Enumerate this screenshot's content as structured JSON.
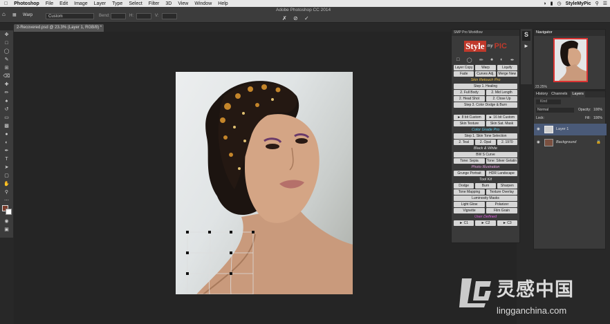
{
  "menubar": {
    "apple": "",
    "items": [
      "Photoshop",
      "File",
      "Edit",
      "Image",
      "Layer",
      "Type",
      "Select",
      "Filter",
      "3D",
      "View",
      "Window",
      "Help"
    ],
    "right_user": "StyleMyPic",
    "right_icons": [
      "wifi-icon",
      "battery-icon",
      "clock-icon",
      "search-icon",
      "list-icon"
    ]
  },
  "options": {
    "tool_label": "Warp",
    "warp_value": "Custom",
    "bend_label": "Bend:",
    "hv_label": "H:",
    "v_label": "V:",
    "window_title": "Adobe Photoshop CC 2014"
  },
  "document": {
    "tab_title": "2-Recovered.psd @ 23.3% (Layer 1, RGB/8) *"
  },
  "smp": {
    "title": "SMP Pro Workflow",
    "logo_style": "Style",
    "logo_my": "my",
    "logo_pic": "PIC",
    "rows": [
      {
        "type": "buttons",
        "items": [
          "Layer Copy",
          "Warp",
          "Liquify"
        ]
      },
      {
        "type": "buttons",
        "items": [
          "Fade",
          "Curves Adj.",
          "Merge New"
        ]
      },
      {
        "type": "section",
        "label": "Skin Retouch Pro",
        "color": "#f0c040"
      },
      {
        "type": "buttons",
        "items": [
          "Step 1. Healing"
        ]
      },
      {
        "type": "buttons",
        "items": [
          "2. Full Body",
          "2. Mid Length"
        ]
      },
      {
        "type": "buttons",
        "items": [
          "2. Head Shot",
          "2. Close Up"
        ]
      },
      {
        "type": "buttons",
        "items": [
          "Step 3. Color Dodge & Burn"
        ]
      },
      {
        "type": "section",
        "label": "",
        "color": "#ccc"
      },
      {
        "type": "buttons",
        "items": [
          "► 8 bit Custom",
          "► 16 bit Custom"
        ]
      },
      {
        "type": "buttons",
        "items": [
          "Skin Texture",
          "Skin Sat. Mask"
        ]
      },
      {
        "type": "section",
        "label": "Color Grade Pro",
        "color": "#5ad0f0"
      },
      {
        "type": "buttons",
        "items": [
          "Step 1. Skin Tone Selection"
        ]
      },
      {
        "type": "buttons",
        "items": [
          "2. Teal",
          "2. Opal",
          "2. 1970"
        ]
      },
      {
        "type": "section",
        "label": "Black & White",
        "color": "#e6e6e6"
      },
      {
        "type": "buttons",
        "items": [
          "BW S Curve"
        ]
      },
      {
        "type": "buttons",
        "items": [
          "Tone: Sepia",
          "Tone: Silver Gelatin"
        ]
      },
      {
        "type": "section",
        "label": "Photo Illustration",
        "color": "#e6a0e0"
      },
      {
        "type": "buttons",
        "items": [
          "Grunge Portrait",
          "HDR Landscape"
        ]
      },
      {
        "type": "section",
        "label": "Tool Kit",
        "color": "#e6e6e6"
      },
      {
        "type": "buttons",
        "items": [
          "Dodge",
          "Burn",
          "Sharpen"
        ]
      },
      {
        "type": "buttons",
        "items": [
          "Tone Mapping",
          "Texture Overlay"
        ]
      },
      {
        "type": "buttons",
        "items": [
          "Luminosity Masks"
        ]
      },
      {
        "type": "buttons",
        "items": [
          "Light Glow",
          "Polarizer"
        ]
      },
      {
        "type": "buttons",
        "items": [
          "Vignette",
          "Film Grain"
        ]
      },
      {
        "type": "section",
        "label": "User Defined",
        "color": "#e060e0"
      },
      {
        "type": "buttons",
        "items": [
          "► C1",
          "► C2",
          "► C3"
        ]
      }
    ]
  },
  "navigator": {
    "title": "Navigator",
    "zoom": "23.25%"
  },
  "layers_panel": {
    "tabs": [
      "History",
      "Channels",
      "Layers"
    ],
    "kind_label": "Kind",
    "blend_mode": "Normal",
    "opacity_label": "Opacity:",
    "opacity_value": "100%",
    "lock_label": "Lock:",
    "fill_label": "Fill:",
    "fill_value": "100%",
    "layers": [
      {
        "name": "Layer 1",
        "selected": true
      },
      {
        "name": "Background",
        "selected": false
      }
    ]
  },
  "watermark": {
    "brand_cn": "灵感中国",
    "brand_url": "lingganchina.com"
  },
  "colors": {
    "accent_selected_layer": "#4a5a78",
    "smp_logo_red": "#c0392b"
  }
}
